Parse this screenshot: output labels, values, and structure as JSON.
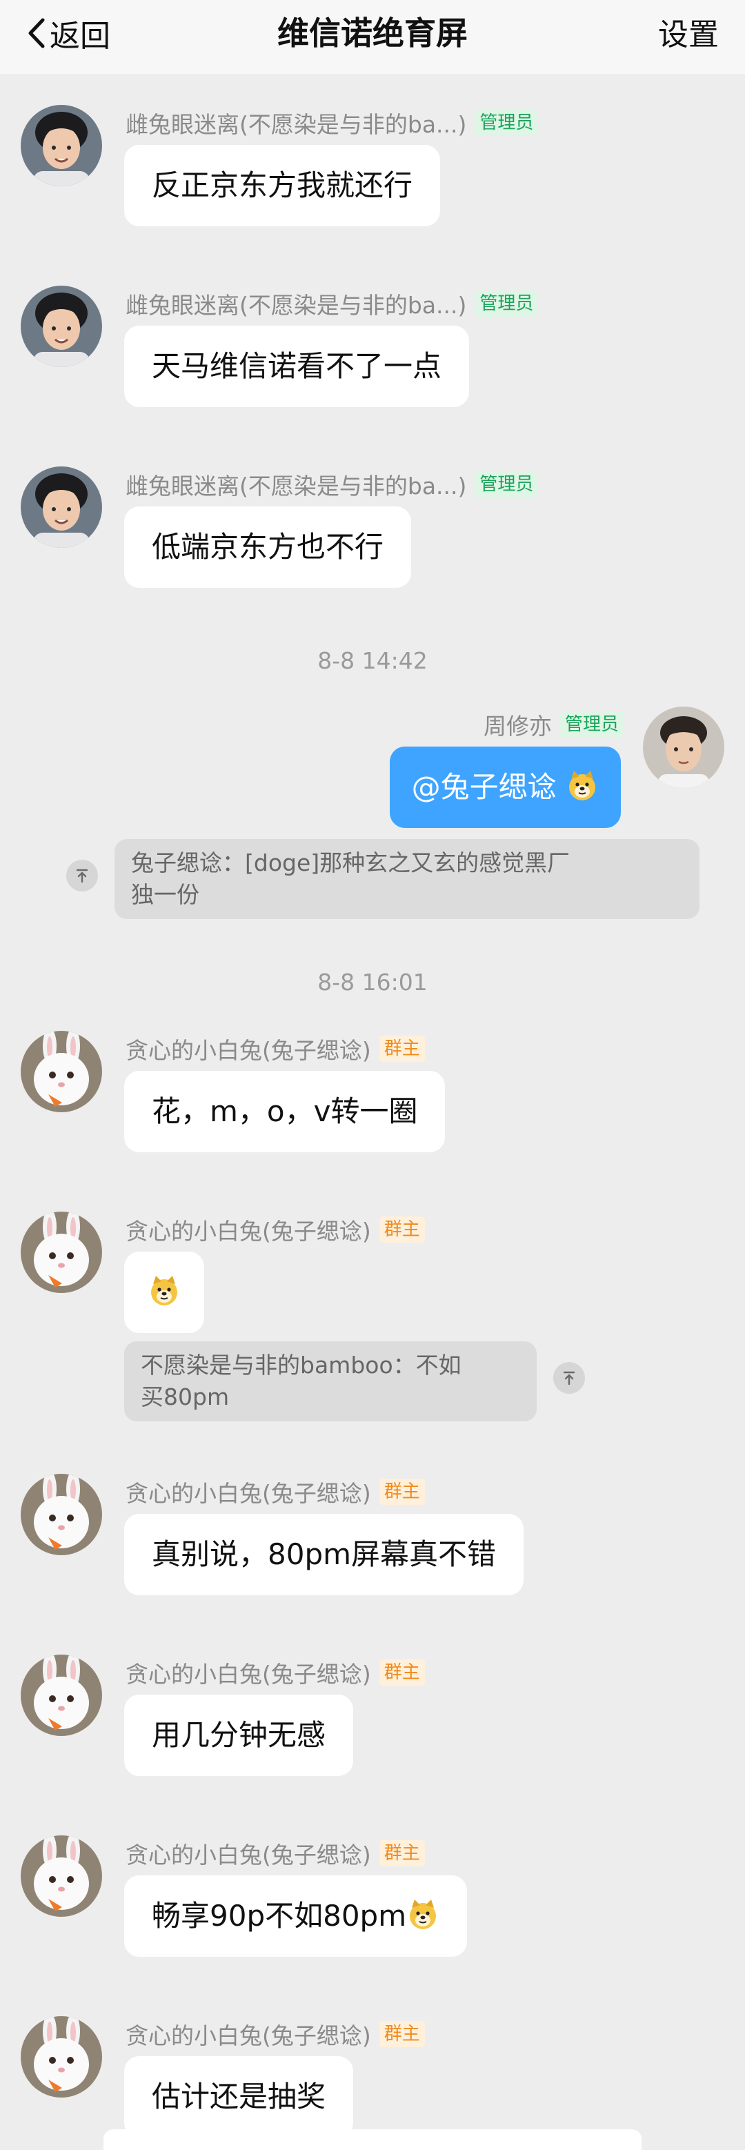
{
  "header": {
    "back_label": "返回",
    "title": "维信诺绝育屏",
    "settings_label": "设置"
  },
  "messages": [
    {
      "sender": "雌兔眼迷离(不愿染是与非的ba...)",
      "badge": "管理员",
      "text": "反正京东方我就还行"
    },
    {
      "sender": "雌兔眼迷离(不愿染是与非的ba...)",
      "badge": "管理员",
      "text": "天马维信诺看不了一点"
    },
    {
      "sender": "雌兔眼迷离(不愿染是与非的ba...)",
      "badge": "管理员",
      "text": "低端京东方也不行"
    },
    {
      "time": "8-8 14:42"
    },
    {
      "sender": "周修亦",
      "badge": "管理员",
      "text": "@兔子缌谂",
      "self": true
    },
    {
      "quote": "兔子缌谂：[doge]那种玄之又玄的感觉黑厂\n独一份"
    },
    {
      "time": "8-8 16:01"
    },
    {
      "sender": "贪心的小白兔(兔子缌谂)",
      "badge": "群主",
      "text": "花，m，o，v转一圈"
    },
    {
      "sender": "贪心的小白兔(兔子缌谂)",
      "badge": "群主",
      "emoji_only": "doge-emoji",
      "quote": "不愿染是与非的bamboo：不如\n买80pm"
    },
    {
      "sender": "贪心的小白兔(兔子缌谂)",
      "badge": "群主",
      "text": "真别说，80pm屏幕真不错"
    },
    {
      "sender": "贪心的小白兔(兔子缌谂)",
      "badge": "群主",
      "text": "用几分钟无感"
    },
    {
      "sender": "贪心的小白兔(兔子缌谂)",
      "badge": "群主",
      "text": "畅享90p不如80pm"
    },
    {
      "sender": "贪心的小白兔(兔子缌谂)",
      "badge": "群主",
      "text": "估计还是抽奖"
    }
  ],
  "colors": {
    "self_bubble": "#3ea4ff",
    "admin_badge": "#1aa35a",
    "owner_badge": "#ef8a1b",
    "background": "#ededed"
  }
}
